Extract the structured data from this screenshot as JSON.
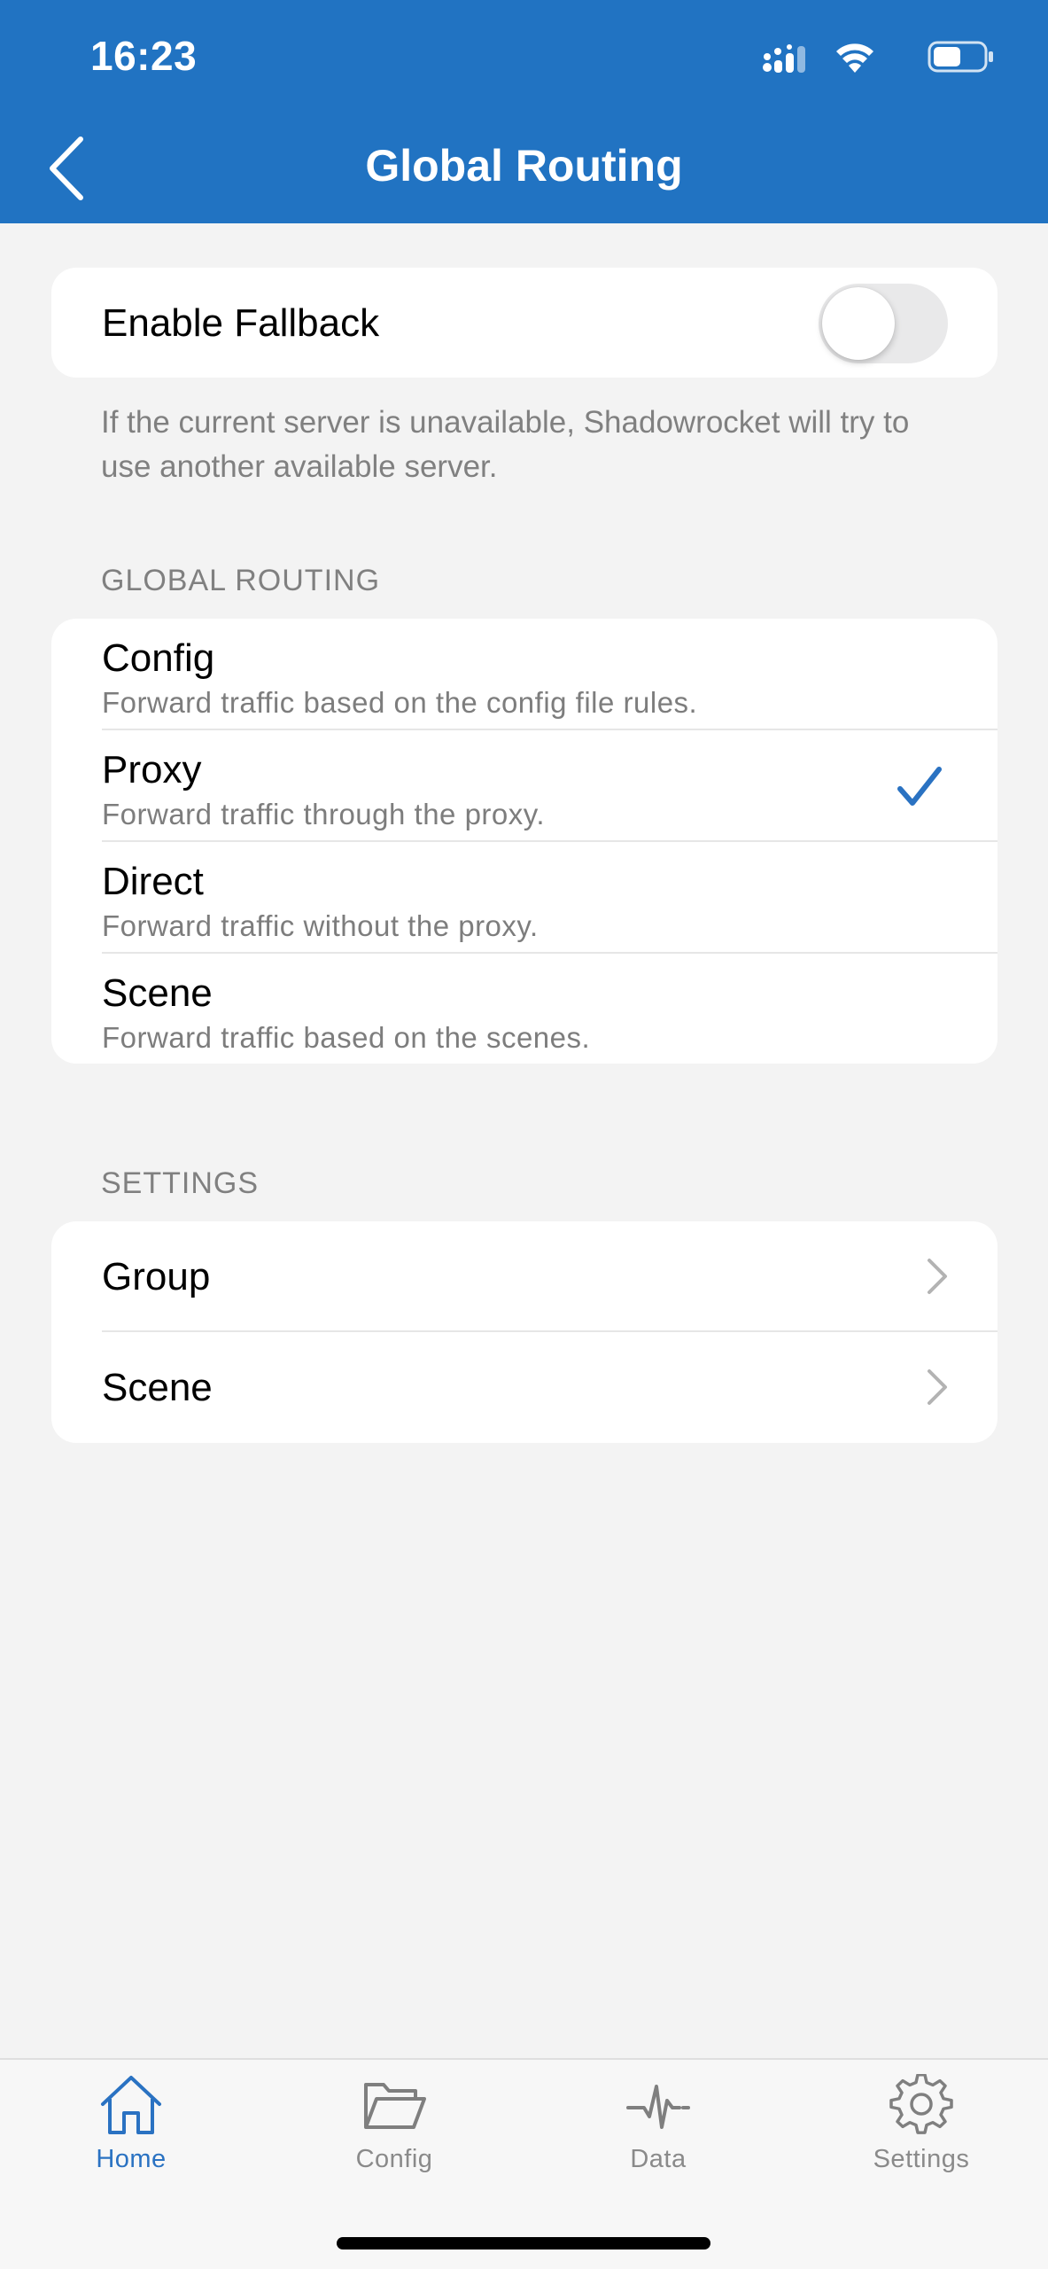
{
  "status_bar": {
    "time": "16:23"
  },
  "nav": {
    "title": "Global Routing"
  },
  "fallback": {
    "label": "Enable Fallback",
    "enabled": false,
    "footnote": "If the current server is unavailable, Shadowrocket will try to use another available server."
  },
  "global_routing": {
    "header": "GLOBAL ROUTING",
    "selected": "Proxy",
    "options": [
      {
        "title": "Config",
        "subtitle": "Forward traffic based on the config file rules."
      },
      {
        "title": "Proxy",
        "subtitle": "Forward traffic through the proxy."
      },
      {
        "title": "Direct",
        "subtitle": "Forward traffic without the proxy."
      },
      {
        "title": "Scene",
        "subtitle": "Forward traffic based on the scenes."
      }
    ]
  },
  "settings": {
    "header": "SETTINGS",
    "items": [
      {
        "label": "Group"
      },
      {
        "label": "Scene"
      }
    ]
  },
  "tabbar": {
    "active": "Home",
    "tabs": [
      {
        "label": "Home",
        "icon": "home-icon"
      },
      {
        "label": "Config",
        "icon": "folder-icon"
      },
      {
        "label": "Data",
        "icon": "pulse-icon"
      },
      {
        "label": "Settings",
        "icon": "gear-icon"
      }
    ]
  },
  "colors": {
    "header": "#2173c2",
    "accent": "#2a72c2",
    "background": "#f3f3f3"
  }
}
